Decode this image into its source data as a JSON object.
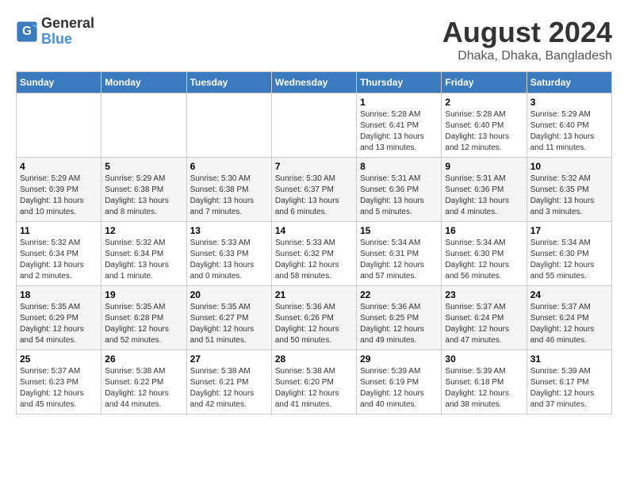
{
  "header": {
    "logo_line1": "General",
    "logo_line2": "Blue",
    "main_title": "August 2024",
    "subtitle": "Dhaka, Dhaka, Bangladesh"
  },
  "days_of_week": [
    "Sunday",
    "Monday",
    "Tuesday",
    "Wednesday",
    "Thursday",
    "Friday",
    "Saturday"
  ],
  "weeks": [
    [
      {
        "day": "",
        "info": ""
      },
      {
        "day": "",
        "info": ""
      },
      {
        "day": "",
        "info": ""
      },
      {
        "day": "",
        "info": ""
      },
      {
        "day": "1",
        "info": "Sunrise: 5:28 AM\nSunset: 6:41 PM\nDaylight: 13 hours\nand 13 minutes."
      },
      {
        "day": "2",
        "info": "Sunrise: 5:28 AM\nSunset: 6:40 PM\nDaylight: 13 hours\nand 12 minutes."
      },
      {
        "day": "3",
        "info": "Sunrise: 5:29 AM\nSunset: 6:40 PM\nDaylight: 13 hours\nand 11 minutes."
      }
    ],
    [
      {
        "day": "4",
        "info": "Sunrise: 5:29 AM\nSunset: 6:39 PM\nDaylight: 13 hours\nand 10 minutes."
      },
      {
        "day": "5",
        "info": "Sunrise: 5:29 AM\nSunset: 6:38 PM\nDaylight: 13 hours\nand 8 minutes."
      },
      {
        "day": "6",
        "info": "Sunrise: 5:30 AM\nSunset: 6:38 PM\nDaylight: 13 hours\nand 7 minutes."
      },
      {
        "day": "7",
        "info": "Sunrise: 5:30 AM\nSunset: 6:37 PM\nDaylight: 13 hours\nand 6 minutes."
      },
      {
        "day": "8",
        "info": "Sunrise: 5:31 AM\nSunset: 6:36 PM\nDaylight: 13 hours\nand 5 minutes."
      },
      {
        "day": "9",
        "info": "Sunrise: 5:31 AM\nSunset: 6:36 PM\nDaylight: 13 hours\nand 4 minutes."
      },
      {
        "day": "10",
        "info": "Sunrise: 5:32 AM\nSunset: 6:35 PM\nDaylight: 13 hours\nand 3 minutes."
      }
    ],
    [
      {
        "day": "11",
        "info": "Sunrise: 5:32 AM\nSunset: 6:34 PM\nDaylight: 13 hours\nand 2 minutes."
      },
      {
        "day": "12",
        "info": "Sunrise: 5:32 AM\nSunset: 6:34 PM\nDaylight: 13 hours\nand 1 minute."
      },
      {
        "day": "13",
        "info": "Sunrise: 5:33 AM\nSunset: 6:33 PM\nDaylight: 13 hours\nand 0 minutes."
      },
      {
        "day": "14",
        "info": "Sunrise: 5:33 AM\nSunset: 6:32 PM\nDaylight: 12 hours\nand 58 minutes."
      },
      {
        "day": "15",
        "info": "Sunrise: 5:34 AM\nSunset: 6:31 PM\nDaylight: 12 hours\nand 57 minutes."
      },
      {
        "day": "16",
        "info": "Sunrise: 5:34 AM\nSunset: 6:30 PM\nDaylight: 12 hours\nand 56 minutes."
      },
      {
        "day": "17",
        "info": "Sunrise: 5:34 AM\nSunset: 6:30 PM\nDaylight: 12 hours\nand 55 minutes."
      }
    ],
    [
      {
        "day": "18",
        "info": "Sunrise: 5:35 AM\nSunset: 6:29 PM\nDaylight: 12 hours\nand 54 minutes."
      },
      {
        "day": "19",
        "info": "Sunrise: 5:35 AM\nSunset: 6:28 PM\nDaylight: 12 hours\nand 52 minutes."
      },
      {
        "day": "20",
        "info": "Sunrise: 5:35 AM\nSunset: 6:27 PM\nDaylight: 12 hours\nand 51 minutes."
      },
      {
        "day": "21",
        "info": "Sunrise: 5:36 AM\nSunset: 6:26 PM\nDaylight: 12 hours\nand 50 minutes."
      },
      {
        "day": "22",
        "info": "Sunrise: 5:36 AM\nSunset: 6:25 PM\nDaylight: 12 hours\nand 49 minutes."
      },
      {
        "day": "23",
        "info": "Sunrise: 5:37 AM\nSunset: 6:24 PM\nDaylight: 12 hours\nand 47 minutes."
      },
      {
        "day": "24",
        "info": "Sunrise: 5:37 AM\nSunset: 6:24 PM\nDaylight: 12 hours\nand 46 minutes."
      }
    ],
    [
      {
        "day": "25",
        "info": "Sunrise: 5:37 AM\nSunset: 6:23 PM\nDaylight: 12 hours\nand 45 minutes."
      },
      {
        "day": "26",
        "info": "Sunrise: 5:38 AM\nSunset: 6:22 PM\nDaylight: 12 hours\nand 44 minutes."
      },
      {
        "day": "27",
        "info": "Sunrise: 5:38 AM\nSunset: 6:21 PM\nDaylight: 12 hours\nand 42 minutes."
      },
      {
        "day": "28",
        "info": "Sunrise: 5:38 AM\nSunset: 6:20 PM\nDaylight: 12 hours\nand 41 minutes."
      },
      {
        "day": "29",
        "info": "Sunrise: 5:39 AM\nSunset: 6:19 PM\nDaylight: 12 hours\nand 40 minutes."
      },
      {
        "day": "30",
        "info": "Sunrise: 5:39 AM\nSunset: 6:18 PM\nDaylight: 12 hours\nand 38 minutes."
      },
      {
        "day": "31",
        "info": "Sunrise: 5:39 AM\nSunset: 6:17 PM\nDaylight: 12 hours\nand 37 minutes."
      }
    ]
  ]
}
